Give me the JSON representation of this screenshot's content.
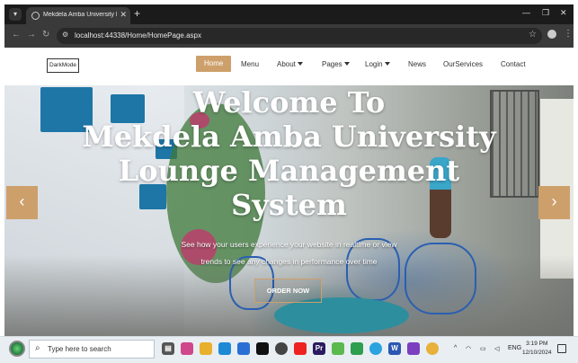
{
  "browser": {
    "tab_title": "Mekdela Amba University Lounge",
    "tab_close": "✕",
    "new_tab": "+",
    "window_controls": [
      "—",
      "❐",
      "✕"
    ],
    "url": "localhost:44338/Home/HomePage.aspx",
    "back_icon": "←",
    "forward_icon": "→",
    "reload_icon": "↻",
    "star_icon": "☆",
    "more_icon": "⋮"
  },
  "nav": {
    "darkmode": "DarkMode",
    "items": [
      {
        "label": "Home",
        "active": true
      },
      {
        "label": "Menu"
      },
      {
        "label": "About",
        "dropdown": true
      },
      {
        "label": "Pages",
        "dropdown": true
      },
      {
        "label": "Login",
        "dropdown": true
      },
      {
        "label": "News"
      },
      {
        "label": "OurServices"
      },
      {
        "label": "Contact"
      }
    ]
  },
  "hero": {
    "title_lines": [
      "Welcome To",
      "Mekdela Amba University",
      "Lounge Management",
      "System"
    ],
    "subtitle_lines": [
      "See how your users experience your website in realtime or view",
      "trends to see any changes in performance over time"
    ],
    "cta": "ORDER NOW",
    "prev": "‹",
    "next": "›",
    "slide_count": 3,
    "active_slide": 2
  },
  "taskbar": {
    "search_placeholder": "Type here to search",
    "search_icon": "⌕",
    "language": "ENG",
    "time": "3:19 PM",
    "date": "12/10/2024",
    "tray_chevron": "^"
  },
  "colors": {
    "accent": "#cda06b",
    "chrome_dark": "#1f1f1f",
    "taskbar": "#e9eef3"
  }
}
